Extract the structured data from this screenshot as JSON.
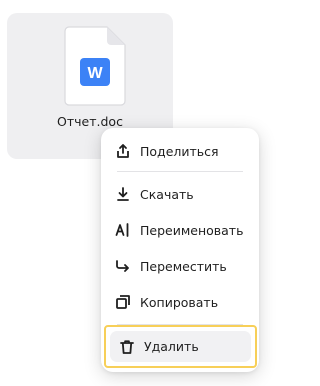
{
  "file": {
    "name": "Отчет.doc",
    "badge_letter": "W",
    "badge_color": "#3c82f6",
    "icon": "word-document-icon"
  },
  "context_menu": {
    "items": [
      {
        "label": "Поделиться",
        "icon": "share-icon"
      },
      {
        "label": "Скачать",
        "icon": "download-icon"
      },
      {
        "label": "Переименовать",
        "icon": "rename-icon"
      },
      {
        "label": "Переместить",
        "icon": "move-icon"
      },
      {
        "label": "Копировать",
        "icon": "copy-icon"
      },
      {
        "label": "Удалить",
        "icon": "trash-icon",
        "highlighted": true
      }
    ],
    "highlight_color": "#f7cf58"
  }
}
